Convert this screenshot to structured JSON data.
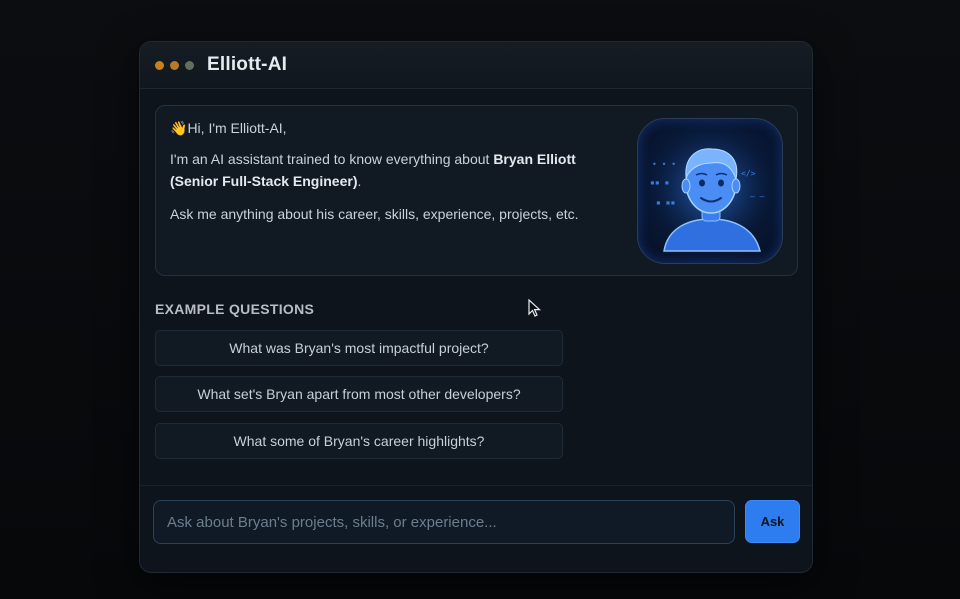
{
  "window": {
    "title": "Elliott-AI"
  },
  "intro": {
    "greeting": "Hi, I'm Elliott-AI,",
    "wave_emoji": "👋",
    "line2_prefix": "I'm an AI assistant trained to know everything about ",
    "line2_bold": "Bryan Elliott (Senior Full-Stack Engineer)",
    "line2_suffix": ".",
    "line3": "Ask me anything about his career, skills, experience, projects, etc."
  },
  "examples": {
    "heading": "EXAMPLE QUESTIONS",
    "questions": [
      "What was Bryan's most impactful project?",
      "What set's Bryan apart from most other developers?",
      "What some of Bryan's career highlights?"
    ]
  },
  "composer": {
    "placeholder": "Ask about Bryan's projects, skills, or experience...",
    "value": "",
    "ask_label": "Ask"
  },
  "colors": {
    "accent": "#2d7cf0",
    "background": "#0d141b"
  }
}
